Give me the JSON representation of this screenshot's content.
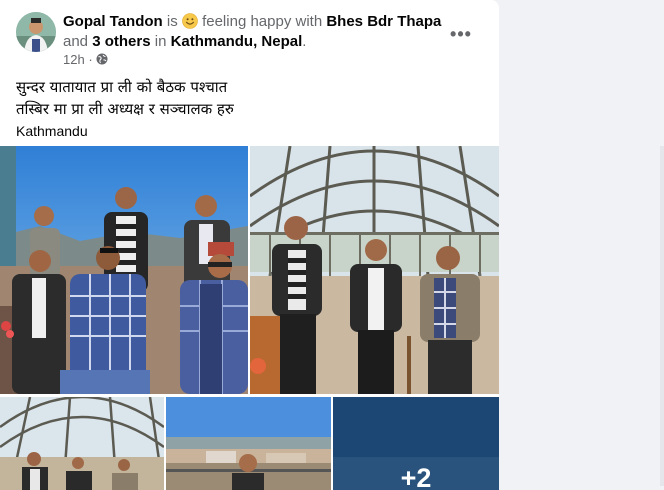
{
  "post": {
    "author": "Gopal Tandon",
    "is_word": "is",
    "feeling_text": "feeling happy with",
    "tagged_person": "Bhes Bdr Thapa",
    "and_word": "and",
    "others_link": "3 others",
    "in_word": "in",
    "location_link": "Kathmandu, Nepal",
    "period": ".",
    "time_ago": "12h",
    "dot_separator": "·",
    "privacy_icon": "globe-icon",
    "more_icon": "more-options-icon",
    "more_glyph": "•••",
    "text_line_1": "सुन्दर यातायात प्रा ली को बैठक पश्चात",
    "text_line_2": "तस्बिर मा प्रा ली अध्यक्ष र सञ्चालक हरु",
    "text_line_3": "Kathmandu",
    "extra_photos_label": "+2"
  },
  "colors": {
    "muted_text": "#65676b",
    "card_bg": "#ffffff",
    "page_bg": "#f0f2f5",
    "emoji_yellow": "#f7c94b"
  }
}
